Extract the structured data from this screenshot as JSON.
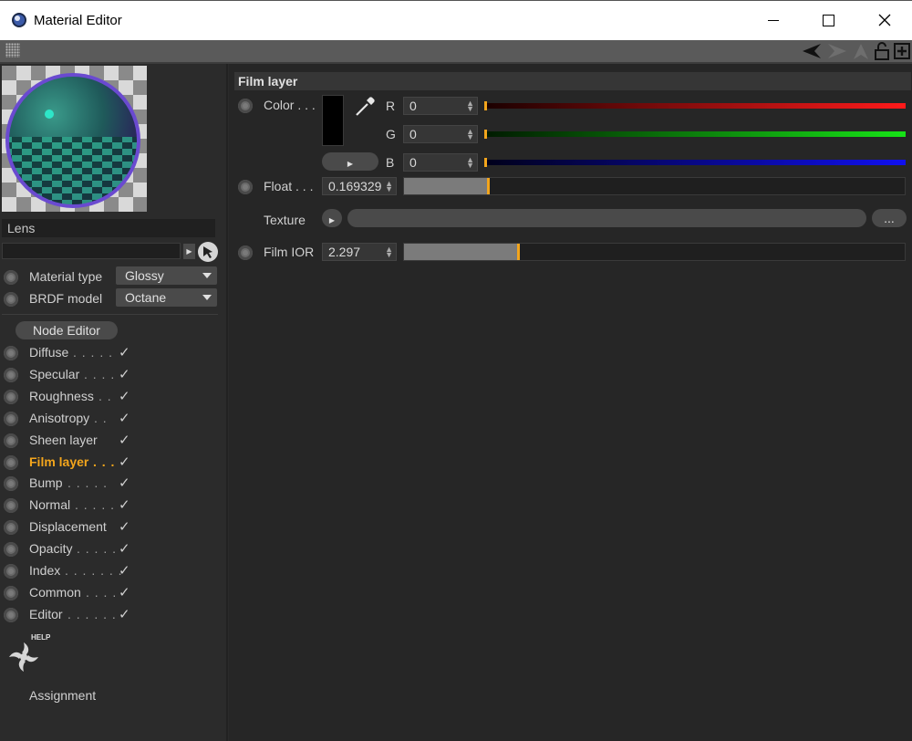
{
  "window": {
    "title": "Material Editor",
    "controls": [
      "minimize-icon",
      "maximize-icon",
      "close-icon"
    ]
  },
  "toolbar": {
    "icons": [
      "back-arrow-icon",
      "forward-arrow-icon",
      "up-arrow-icon",
      "lock-icon",
      "new-panel-icon"
    ]
  },
  "material": {
    "name": "Lens",
    "search_value": ""
  },
  "properties": {
    "material_type": {
      "label": "Material type",
      "value": "Glossy"
    },
    "brdf_model": {
      "label": "BRDF model",
      "value": "Octane"
    }
  },
  "node_editor_label": "Node Editor",
  "channels": [
    {
      "name": "Diffuse",
      "dots": ". . . . .",
      "checked": true,
      "active": false
    },
    {
      "name": "Specular",
      "dots": ". . . .",
      "checked": true,
      "active": false
    },
    {
      "name": "Roughness",
      "dots": ". .",
      "checked": true,
      "active": false
    },
    {
      "name": "Anisotropy",
      "dots": ". .",
      "checked": true,
      "active": false
    },
    {
      "name": "Sheen layer",
      "dots": "",
      "checked": true,
      "active": false
    },
    {
      "name": "Film layer",
      "dots": ". . .",
      "checked": true,
      "active": true
    },
    {
      "name": "Bump",
      "dots": ". . . . .",
      "checked": true,
      "active": false
    },
    {
      "name": "Normal",
      "dots": ". . . . .",
      "checked": true,
      "active": false
    },
    {
      "name": "Displacement",
      "dots": "",
      "checked": true,
      "active": false
    },
    {
      "name": "Opacity",
      "dots": ". . . . .",
      "checked": true,
      "active": false
    },
    {
      "name": "Index",
      "dots": ". . . . . . .",
      "checked": true,
      "active": false
    },
    {
      "name": "Common",
      "dots": ". . . .",
      "checked": true,
      "active": false
    },
    {
      "name": "Editor",
      "dots": ". . . . . .",
      "checked": true,
      "active": false
    }
  ],
  "check_glyph": "✓",
  "help": {
    "badge": "HELP",
    "icon": "octane-help-icon"
  },
  "assignment_label": "Assignment",
  "film_layer": {
    "section_title": "Film layer",
    "color": {
      "label": "Color . . .",
      "r_label": "R",
      "r_value": "0",
      "g_label": "G",
      "g_value": "0",
      "b_label": "B",
      "b_value": "0",
      "swatch": "#000000"
    },
    "float": {
      "label": "Float . . .",
      "value": "0.169329",
      "fraction": 0.169329
    },
    "texture": {
      "label": "Texture",
      "browse_label": "..."
    },
    "film_ior": {
      "label": "Film IOR",
      "value": "2.297",
      "fraction": 0.2297
    }
  },
  "colors": {
    "accent": "#f3a51c",
    "red": "#ff1a1a",
    "green": "#17e317",
    "blue": "#1010f0"
  }
}
